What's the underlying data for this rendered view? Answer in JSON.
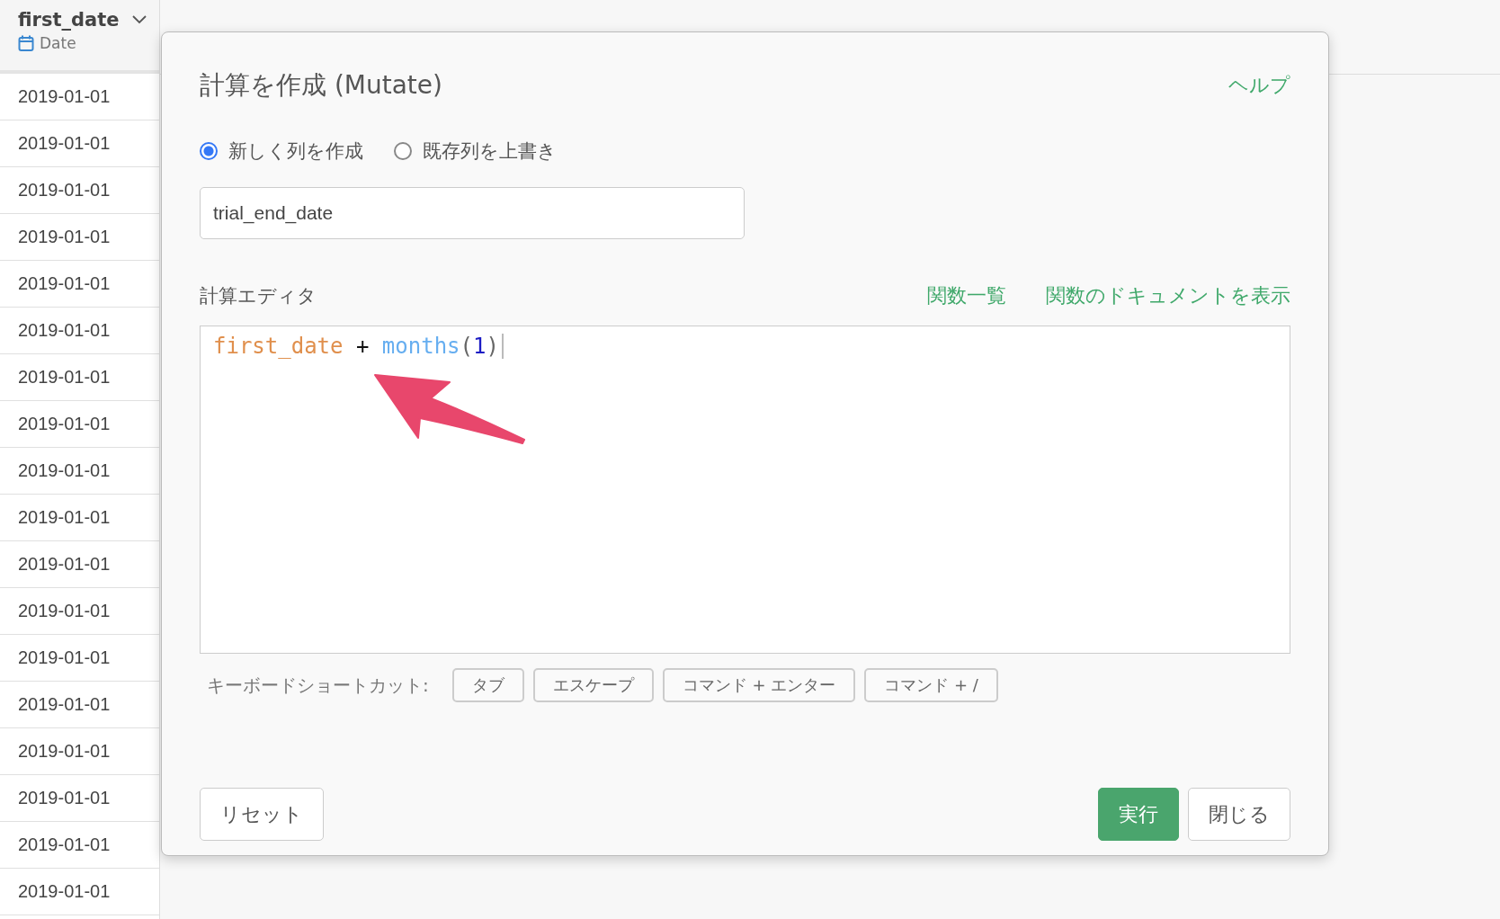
{
  "column": {
    "name": "first_date",
    "type": "Date",
    "cells": [
      "2019-01-01",
      "2019-01-01",
      "2019-01-01",
      "2019-01-01",
      "2019-01-01",
      "2019-01-01",
      "2019-01-01",
      "2019-01-01",
      "2019-01-01",
      "2019-01-01",
      "2019-01-01",
      "2019-01-01",
      "2019-01-01",
      "2019-01-01",
      "2019-01-01",
      "2019-01-01",
      "2019-01-01",
      "2019-01-01"
    ]
  },
  "dialog": {
    "title": "計算を作成 (Mutate)",
    "help": "ヘルプ",
    "modes": [
      {
        "label": "新しく列を作成",
        "selected": true
      },
      {
        "label": "既存列を上書き",
        "selected": false
      }
    ],
    "column_name": {
      "value": "trial_end_date"
    },
    "editor_label": "計算エディタ",
    "links": [
      "関数一覧",
      "関数のドキュメントを表示"
    ],
    "code": [
      {
        "text": "first_date",
        "kind": "column"
      },
      {
        "text": "+",
        "kind": "operator"
      },
      {
        "text": "months",
        "kind": "function"
      },
      {
        "text": "(",
        "kind": "paren"
      },
      {
        "text": "1",
        "kind": "number"
      },
      {
        "text": ")",
        "kind": "paren"
      }
    ],
    "shortcuts_label": "キーボードショートカット:",
    "shortcuts": [
      "タブ",
      "エスケープ",
      "コマンド + エンター",
      "コマンド + /"
    ],
    "reset": "リセット",
    "run": "実行",
    "close": "閉じる"
  }
}
